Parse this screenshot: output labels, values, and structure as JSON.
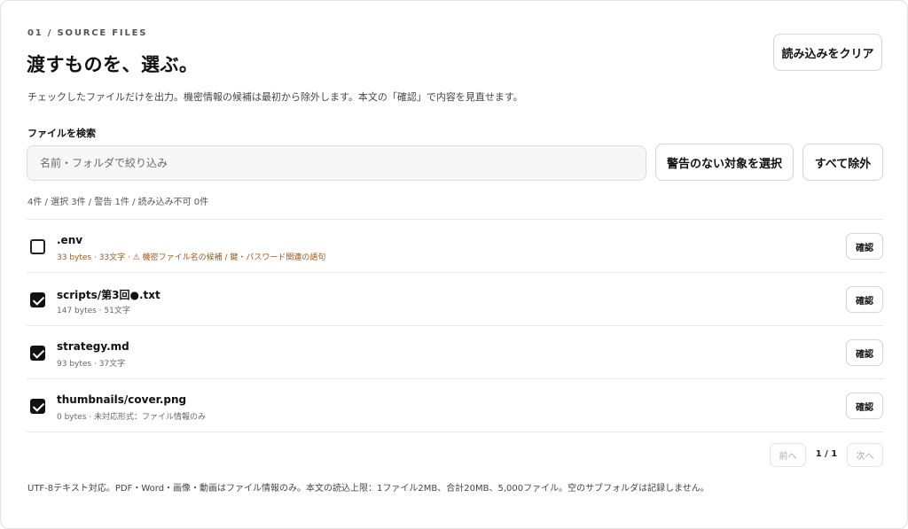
{
  "header": {
    "eyebrow": "01 / SOURCE FILES",
    "title": "渡すものを、選ぶ。",
    "description": "チェックしたファイルだけを出力。機密情報の候補は最初から除外します。本文の「確認」で内容を見直せます。",
    "clear_button": "読み込みをクリア"
  },
  "search": {
    "label": "ファイルを検索",
    "placeholder": "名前・フォルダで絞り込み",
    "value": "",
    "select_safe_button": "警告のない対象を選択",
    "exclude_all_button": "すべて除外"
  },
  "summary": "4件 / 選択 3件 / 警告 1件 / 読み込み不可 0件",
  "files": [
    {
      "name": ".env",
      "meta": "33 bytes · 33文字 · ⚠ 機密ファイル名の候補 / 鍵・パスワード関連の語句",
      "checked": false,
      "warning": true,
      "confirm_label": "確認"
    },
    {
      "name": "scripts/第3回●.txt",
      "meta": "147 bytes · 51文字",
      "checked": true,
      "warning": false,
      "confirm_label": "確認"
    },
    {
      "name": "strategy.md",
      "meta": "93 bytes · 37文字",
      "checked": true,
      "warning": false,
      "confirm_label": "確認"
    },
    {
      "name": "thumbnails/cover.png",
      "meta": "0 bytes · 未対応形式：ファイル情報のみ",
      "checked": true,
      "warning": false,
      "confirm_label": "確認"
    }
  ],
  "pager": {
    "prev": "前へ",
    "indicator": "1 / 1",
    "next": "次へ"
  },
  "footer": "UTF-8テキスト対応。PDF・Word・画像・動画はファイル情報のみ。本文の読込上限：1ファイル2MB、合計20MB、5,000ファイル。空のサブフォルダは記録しません。",
  "colors": {
    "warning_text": "#9a5a1c",
    "checkbox_checked": "#111111"
  }
}
